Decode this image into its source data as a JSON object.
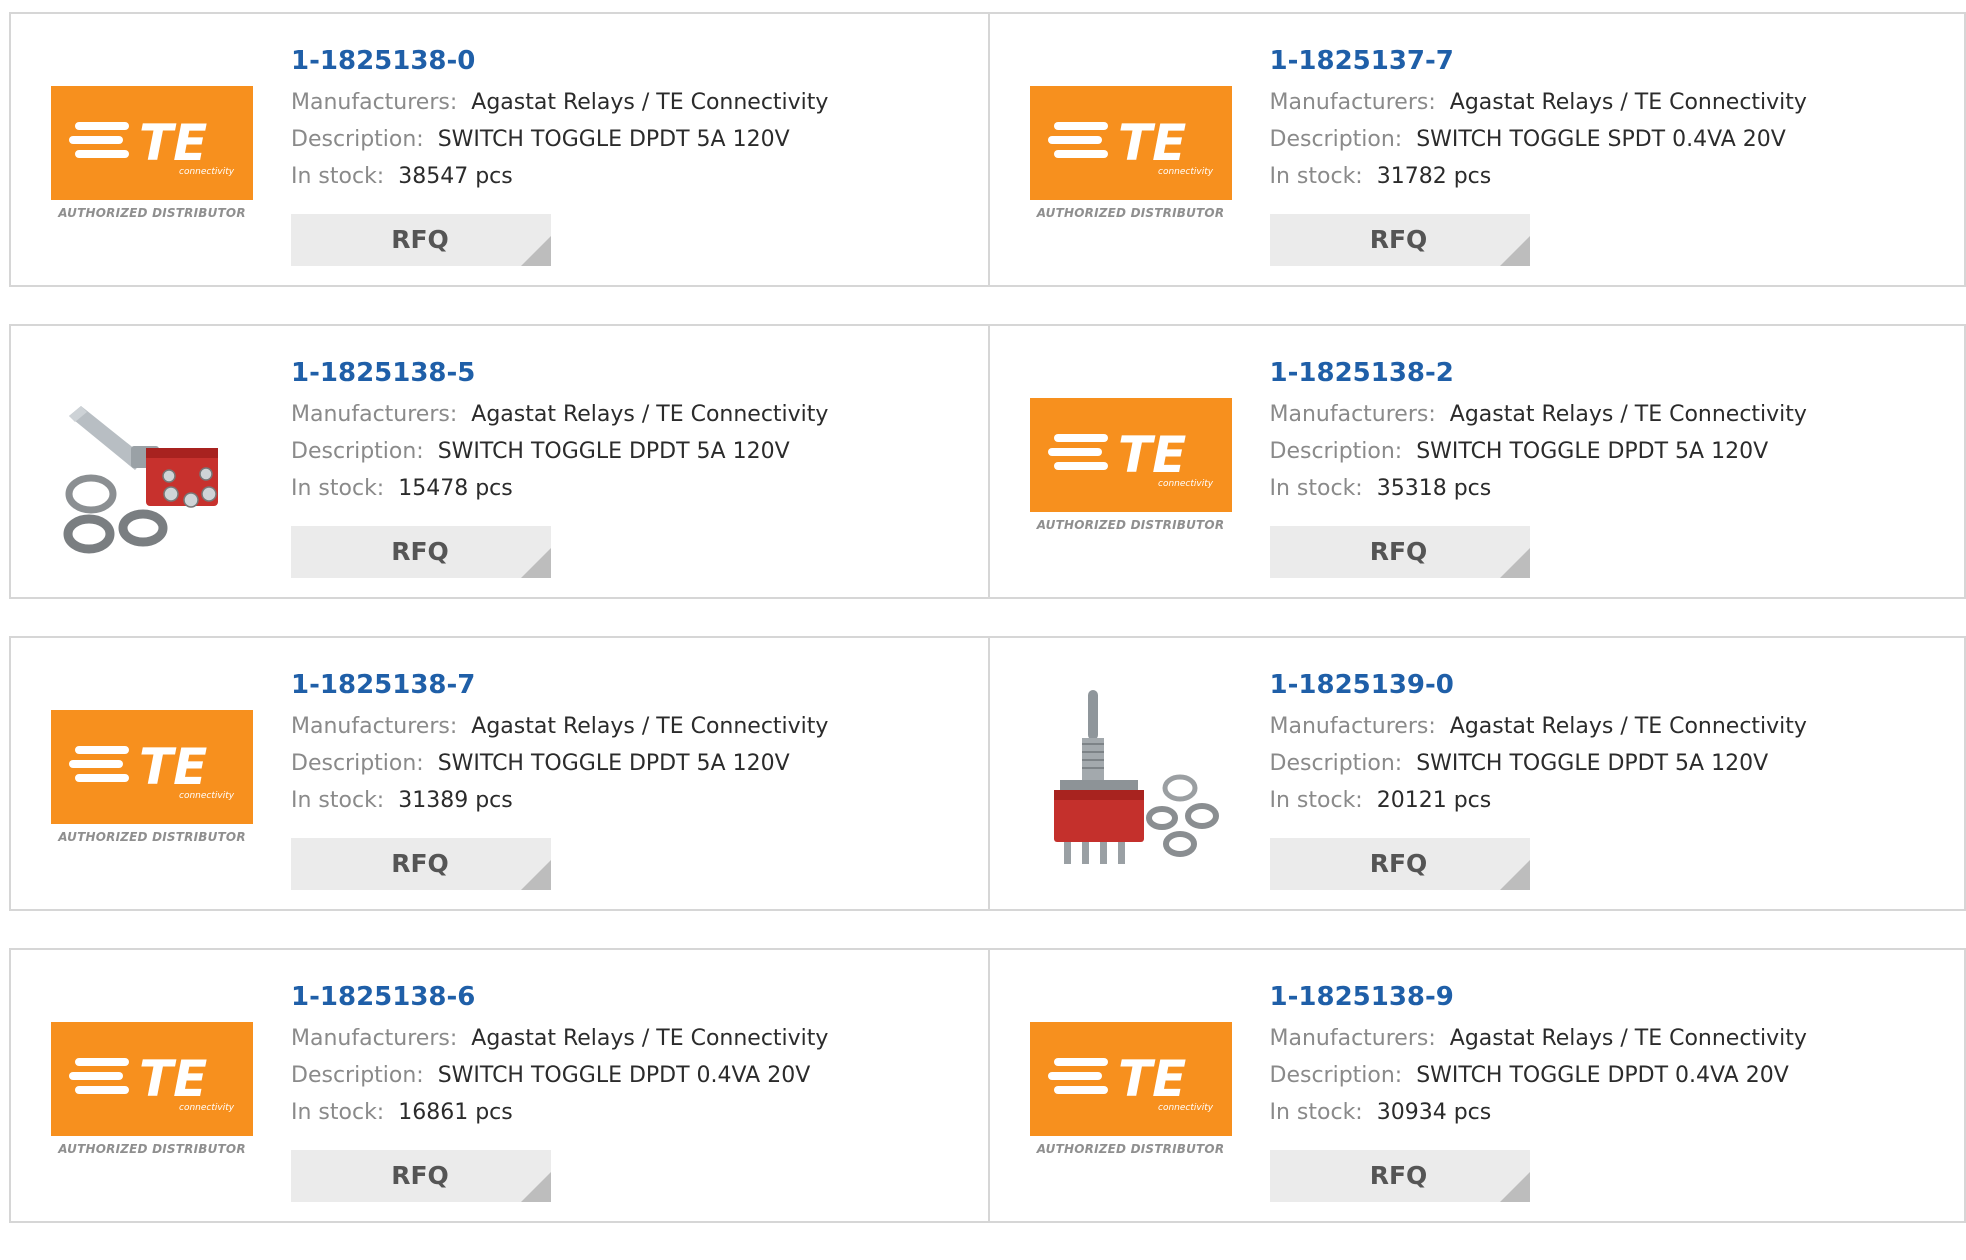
{
  "labels": {
    "manufacturers": "Manufacturers:",
    "description": "Description:",
    "stock": "In stock:",
    "rfq": "RFQ",
    "unit": "pcs",
    "distributor": "AUTHORIZED DISTRIBUTOR",
    "logo_text": "TE",
    "logo_sub": "connectivity"
  },
  "colors": {
    "part_link": "#1f5fa8",
    "logo_orange": "#f7901e",
    "rfq_bg": "#ebebeb"
  },
  "products": [
    {
      "part": "1-1825138-0",
      "manufacturer": "Agastat Relays / TE Connectivity",
      "description": "SWITCH TOGGLE DPDT 5A 120V",
      "stock": "38547 pcs",
      "image": "te-logo"
    },
    {
      "part": "1-1825137-7",
      "manufacturer": "Agastat Relays / TE Connectivity",
      "description": "SWITCH TOGGLE SPDT 0.4VA 20V",
      "stock": "31782 pcs",
      "image": "te-logo"
    },
    {
      "part": "1-1825138-5",
      "manufacturer": "Agastat Relays / TE Connectivity",
      "description": "SWITCH TOGGLE DPDT 5A 120V",
      "stock": "15478 pcs",
      "image": "toggle-switch-photo-side"
    },
    {
      "part": "1-1825138-2",
      "manufacturer": "Agastat Relays / TE Connectivity",
      "description": "SWITCH TOGGLE DPDT 5A 120V",
      "stock": "35318 pcs",
      "image": "te-logo"
    },
    {
      "part": "1-1825138-7",
      "manufacturer": "Agastat Relays / TE Connectivity",
      "description": "SWITCH TOGGLE DPDT 5A 120V",
      "stock": "31389 pcs",
      "image": "te-logo"
    },
    {
      "part": "1-1825139-0",
      "manufacturer": "Agastat Relays / TE Connectivity",
      "description": "SWITCH TOGGLE DPDT 5A 120V",
      "stock": "20121 pcs",
      "image": "toggle-switch-photo-upright"
    },
    {
      "part": "1-1825138-6",
      "manufacturer": "Agastat Relays / TE Connectivity",
      "description": "SWITCH TOGGLE DPDT 0.4VA 20V",
      "stock": "16861 pcs",
      "image": "te-logo"
    },
    {
      "part": "1-1825138-9",
      "manufacturer": "Agastat Relays / TE Connectivity",
      "description": "SWITCH TOGGLE DPDT 0.4VA 20V",
      "stock": "30934 pcs",
      "image": "te-logo"
    }
  ]
}
